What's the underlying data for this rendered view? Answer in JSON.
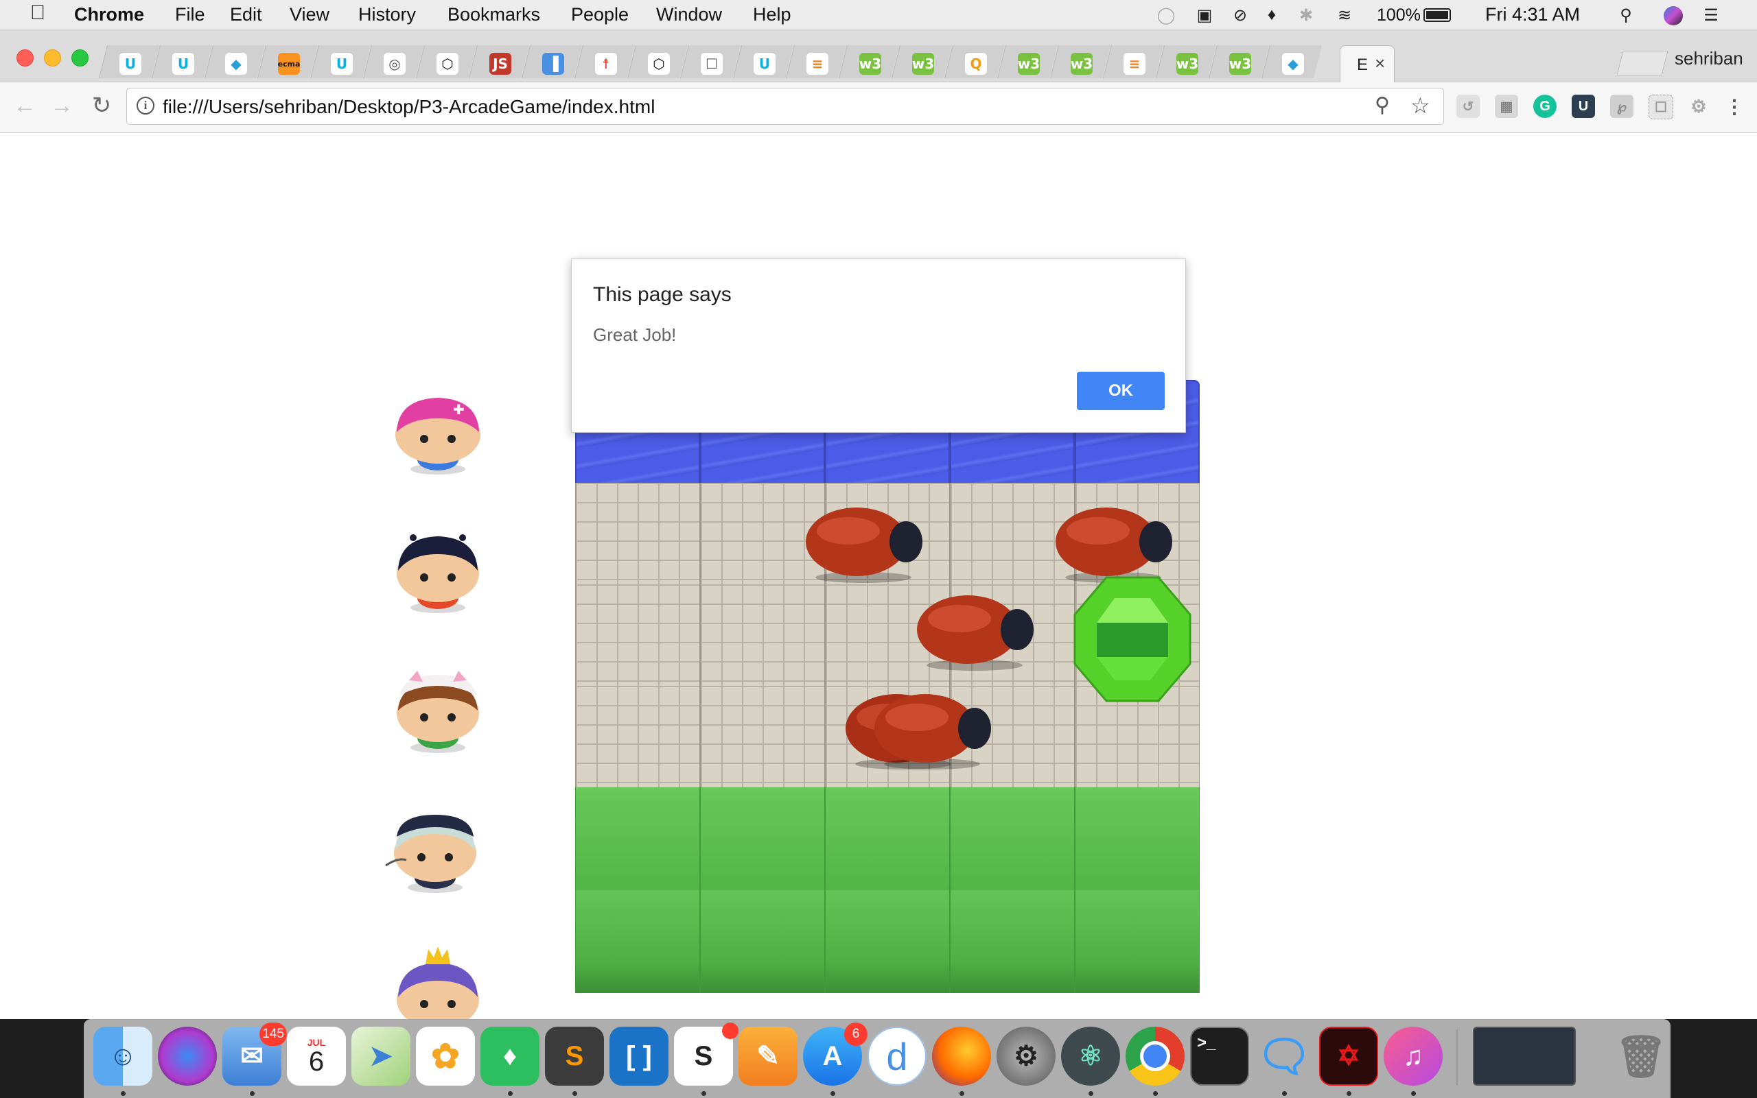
{
  "menubar": {
    "app_name": "Chrome",
    "items": [
      "File",
      "Edit",
      "View",
      "History",
      "Bookmarks",
      "People",
      "Window",
      "Help"
    ],
    "battery": "100%",
    "clock": "Fri 4:31 AM"
  },
  "tabs": {
    "active_title": "E",
    "profile_name": "sehriban",
    "favicon_icons": [
      "udacity-icon",
      "udacity-icon",
      "panther-icon",
      "ecma-icon",
      "udacity-icon",
      "swirl-icon",
      "codepen-icon",
      "js-icon",
      "bars-icon",
      "figure-icon",
      "codepen-icon",
      "document-icon",
      "udacity-icon",
      "stackoverflow-icon",
      "w3-icon",
      "w3-icon",
      "q-icon",
      "w3-icon",
      "w3-icon",
      "stackoverflow-icon",
      "w3-icon",
      "w3-icon",
      "panther-icon"
    ],
    "favicon_labels": {
      "ecma": "ecma",
      "js": "JS",
      "w3": "w3",
      "q": "Q"
    }
  },
  "toolbar": {
    "url": "file:///Users/sehriban/Desktop/P3-ArcadeGame/index.html"
  },
  "dialog": {
    "title": "This page says",
    "message": "Great Job!",
    "ok_label": "OK"
  },
  "game": {
    "columns": 5,
    "rows": [
      "water",
      "stone",
      "stone",
      "stone",
      "grass",
      "grass"
    ],
    "characters": [
      "char-pink-girl",
      "char-boy",
      "char-cat-girl",
      "char-horn-girl",
      "char-princess-girl"
    ],
    "enemy_count": 5,
    "gem_color": "#55d12a"
  },
  "dock": {
    "apps": [
      "finder-icon",
      "siri-icon",
      "mail-icon",
      "calendar-icon",
      "maps-icon",
      "photos-icon",
      "evernote-icon",
      "sublime-icon",
      "brackets-icon",
      "slack-icon",
      "pages-icon",
      "app-store-icon",
      "dash-icon",
      "firefox-icon",
      "system-preferences-icon",
      "atom-icon",
      "chrome-icon",
      "terminal-icon",
      "messages-icon",
      "acrobat-icon",
      "itunes-icon",
      "terminal-window-icon",
      "trash-icon"
    ],
    "mail_badge": "145",
    "calendar_month": "JUL",
    "calendar_day": "6",
    "appstore_badge": "6",
    "slack_letter": "S",
    "terminal_prompt": ">_"
  },
  "colors": {
    "ok_button": "#4285f4",
    "water": "#4d5ce8",
    "grass": "#5bbf4f",
    "stone": "#d9d3c6"
  }
}
